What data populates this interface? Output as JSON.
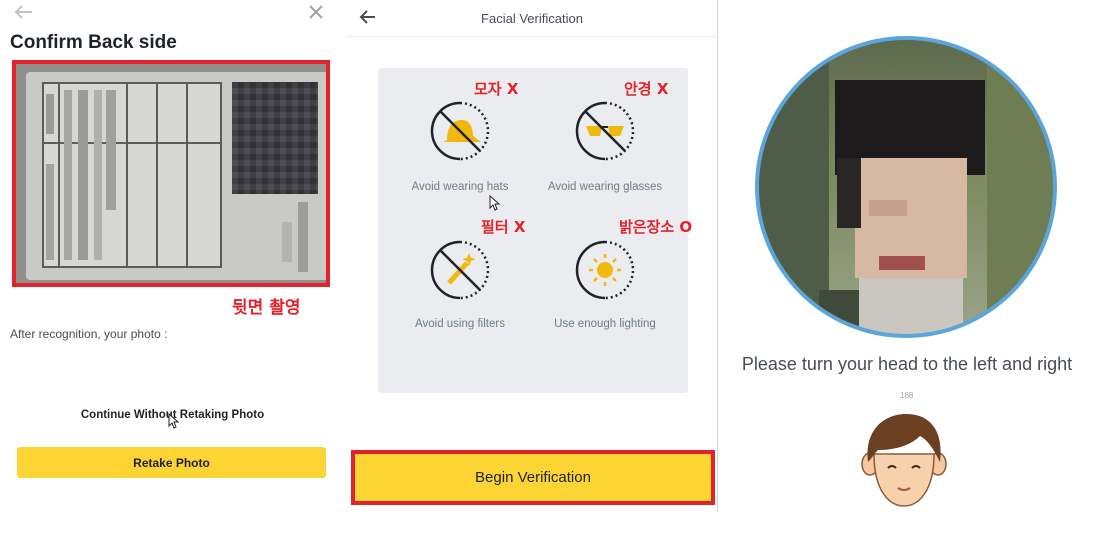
{
  "upload_screen": {
    "title": "Confirm Back side",
    "annotation": "뒷면 촬영",
    "after_text": "After recognition, your photo :",
    "continue_label": "Continue Without Retaking Photo",
    "retake_label": "Retake Photo"
  },
  "facial_screen": {
    "title": "Facial Verification",
    "tips": [
      {
        "label": "Avoid wearing hats",
        "icon": "hat-crossed-icon",
        "note": "모자 X"
      },
      {
        "label": "Avoid wearing glasses",
        "icon": "glasses-crossed-icon",
        "note": "안경 X"
      },
      {
        "label": "Avoid using filters",
        "icon": "filter-wand-crossed-icon",
        "note": "필터 X"
      },
      {
        "label": "Use enough lighting",
        "icon": "sun-icon",
        "note": "밝은장소 O"
      }
    ],
    "begin_label": "Begin Verification"
  },
  "liveness_screen": {
    "instruction": "Please turn your head to the left and right",
    "progress_text": "188"
  },
  "colors": {
    "accent_yellow": "#fcd535",
    "highlight_red": "#e3232b",
    "ring_blue": "#5aa6dc"
  }
}
